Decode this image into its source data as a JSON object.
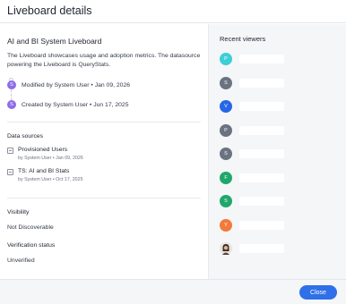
{
  "header": {
    "title": "Liveboard details"
  },
  "liveboard": {
    "title": "AI and BI System Liveboard",
    "description": "The Liveboard showcases usage and adoption metrics. The datasource powering the Liveboard is QueryStats.",
    "history": [
      {
        "avatar_letter": "S",
        "text": "Modified by System User • Jan 09, 2026"
      },
      {
        "avatar_letter": "S",
        "text": "Created by System User • Jun 17, 2025"
      }
    ]
  },
  "data_sources": {
    "label": "Data sources",
    "items": [
      {
        "name": "Provisioned Users",
        "meta": "by System User • Jan 09, 2026",
        "icon": "table-icon"
      },
      {
        "name": "TS: AI and BI Stats",
        "meta": "by System User • Oct 17, 2025",
        "icon": "table-icon"
      }
    ]
  },
  "visibility": {
    "label": "Visibility",
    "value": "Not Discoverable"
  },
  "verification": {
    "label": "Verification status",
    "value": "Unverified"
  },
  "recent_viewers": {
    "title": "Recent viewers",
    "viewers": [
      {
        "letter": "P",
        "color": "#3dcfd6"
      },
      {
        "letter": "S",
        "color": "#6b7280"
      },
      {
        "letter": "V",
        "color": "#2767e6"
      },
      {
        "letter": "P",
        "color": "#6b7280"
      },
      {
        "letter": "S",
        "color": "#6b7280"
      },
      {
        "letter": "F",
        "color": "#20a86b"
      },
      {
        "letter": "S",
        "color": "#20a86b"
      },
      {
        "letter": "Y",
        "color": "#f27a3a"
      },
      {
        "letter": "",
        "color": "#7a5a48",
        "photo": true
      }
    ]
  },
  "footer": {
    "close_label": "Close"
  },
  "colors": {
    "accent": "#2f6fe8",
    "avatar_purple": "#8e6de6"
  }
}
